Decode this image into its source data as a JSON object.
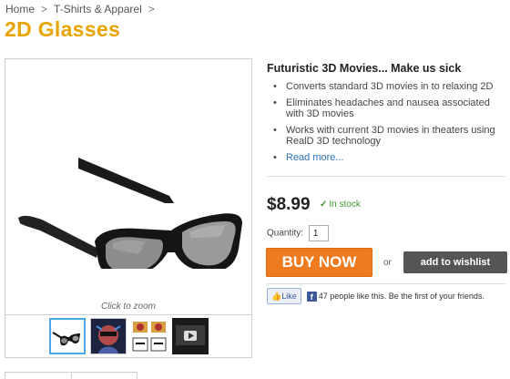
{
  "breadcrumb": {
    "items": [
      "Home",
      "T-Shirts & Apparel"
    ],
    "separator": ">"
  },
  "product": {
    "title": "2D Glasses",
    "tagline": "Futuristic 3D Movies... Make us sick",
    "features": [
      "Converts standard 3D movies in to relaxing 2D",
      "Eliminates headaches and nausea associated with 3D movies",
      "Works with current 3D movies in theaters using RealD 3D technology"
    ],
    "read_more": "Read more...",
    "price": "$8.99",
    "stock": "In stock",
    "stock_check": "✓",
    "quantity_label": "Quantity:",
    "quantity_value": "1"
  },
  "gallery": {
    "zoom_caption": "Click to zoom",
    "thumbnails": [
      "glasses-thumb",
      "person-thumb",
      "packaging-thumb",
      "video-thumb"
    ]
  },
  "actions": {
    "buy_label": "BUY NOW",
    "or_label": "or",
    "wishlist_label": "add to wishlist"
  },
  "social": {
    "like_label": "Like",
    "like_text": "47 people like this. Be the first of your friends."
  },
  "colors": {
    "title": "#e8a400",
    "buy_button": "#f07a1e",
    "wishlist_button": "#555555",
    "in_stock": "#3a9a2a",
    "link": "#2a6fb7",
    "thumb_active_border": "#49a7e6"
  }
}
